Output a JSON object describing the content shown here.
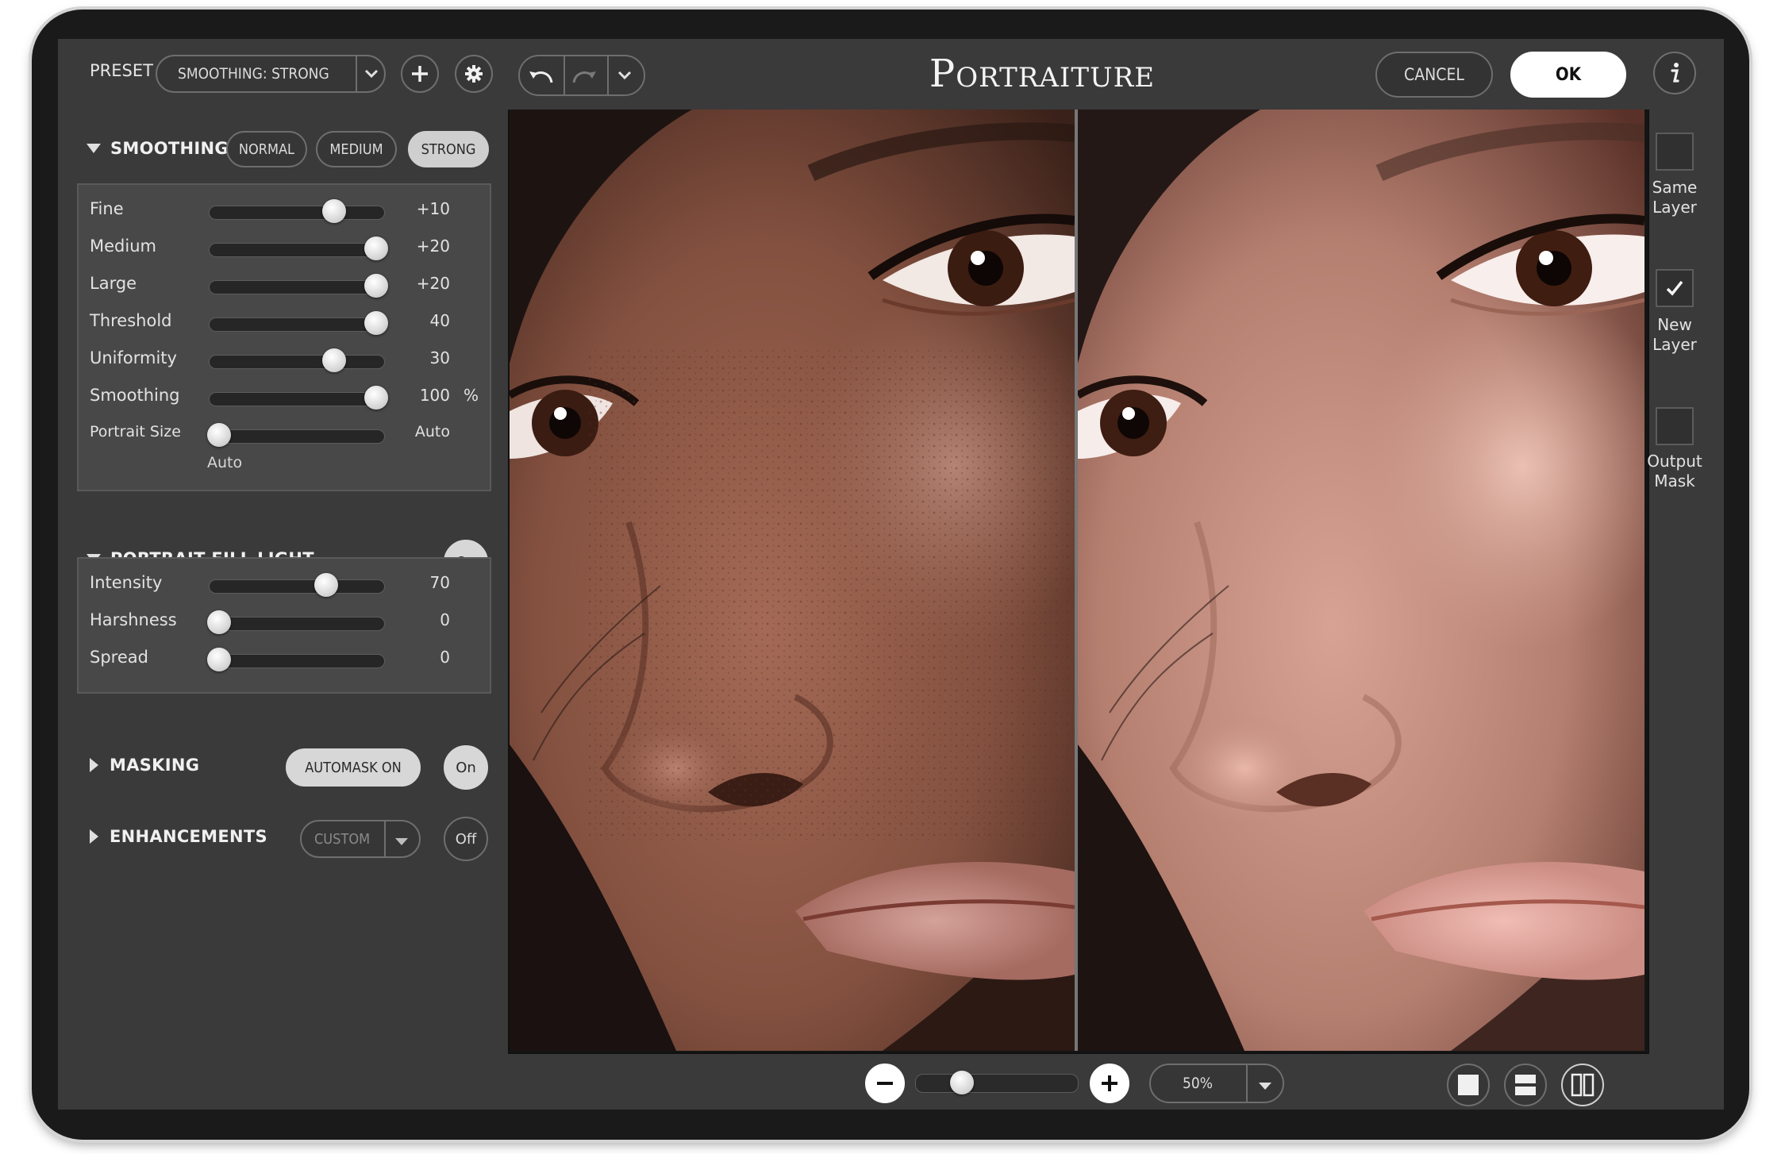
{
  "app": {
    "title": "Portraiture"
  },
  "toolbar": {
    "preset_label": "PRESET",
    "preset_value": "SMOOTHING: STRONG",
    "cancel_label": "CANCEL",
    "ok_label": "OK"
  },
  "smoothing": {
    "title": "SMOOTHING",
    "modes": [
      "NORMAL",
      "MEDIUM",
      "STRONG"
    ],
    "active_mode": "STRONG",
    "sliders": [
      {
        "label": "Fine",
        "value": "+10",
        "unit": "",
        "level": 0.73
      },
      {
        "label": "Medium",
        "value": "+20",
        "unit": "",
        "level": 1.0
      },
      {
        "label": "Large",
        "value": "+20",
        "unit": "",
        "level": 1.0
      },
      {
        "label": "Threshold",
        "value": "40",
        "unit": "",
        "level": 1.0
      },
      {
        "label": "Uniformity",
        "value": "30",
        "unit": "",
        "level": 0.73
      },
      {
        "label": "Smoothing",
        "value": "100",
        "unit": "%",
        "level": 1.0
      },
      {
        "label": "Portrait Size",
        "value": "Auto",
        "unit": "",
        "level": 0.0
      }
    ],
    "portrait_size_sublabel": "Auto"
  },
  "fill_light": {
    "title": "PORTRAIT FILL LIGHT",
    "toggle": "On",
    "sliders": [
      {
        "label": "Intensity",
        "value": "70",
        "level": 0.68
      },
      {
        "label": "Harshness",
        "value": "0",
        "level": 0.0
      },
      {
        "label": "Spread",
        "value": "0",
        "level": 0.0
      }
    ]
  },
  "masking": {
    "title": "MASKING",
    "automask": "AUTOMASK ON",
    "toggle": "On"
  },
  "enhancements": {
    "title": "ENHANCEMENTS",
    "select": "CUSTOM",
    "toggle": "Off"
  },
  "output": {
    "same_layer": "Same\nLayer",
    "same_layer_checked": false,
    "new_layer": "New\nLayer",
    "new_layer_checked": true,
    "output_mask": "Output\nMask",
    "output_mask_checked": false
  },
  "zoom": {
    "value": "50%",
    "level": 0.25
  },
  "colors": {
    "panel_bg": "#3a3a3a",
    "section_bg": "#484848",
    "active_pill": "#cfcfcf",
    "ok_button": "#ffffff"
  }
}
